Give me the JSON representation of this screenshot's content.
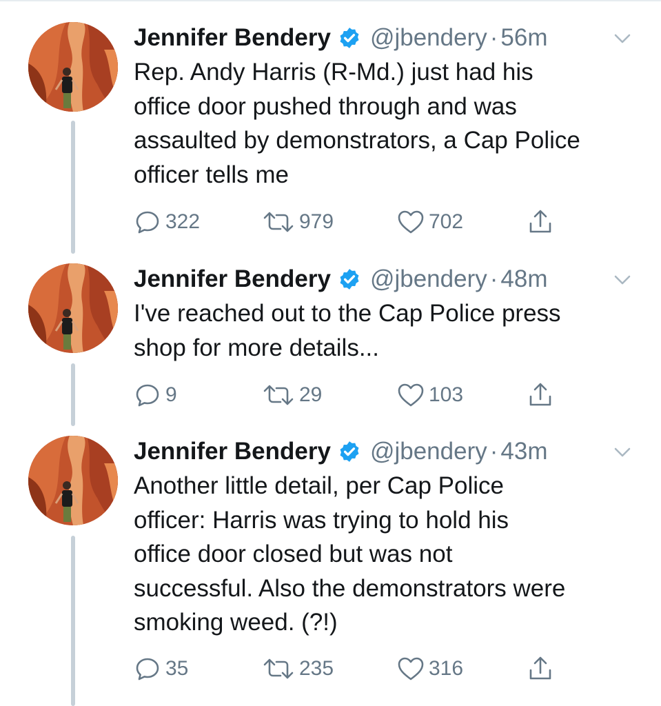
{
  "tweets": [
    {
      "name": "Jennifer Bendery",
      "handle": "@jbendery",
      "separator": "·",
      "time": "56m",
      "text": "Rep. Andy Harris (R-Md.) just had his\noffice door pushed through and was\nassaulted by demonstrators, a Cap Police\nofficer tells me",
      "replies": "322",
      "retweets": "979",
      "likes": "702"
    },
    {
      "name": "Jennifer Bendery",
      "handle": "@jbendery",
      "separator": "·",
      "time": "48m",
      "text": "I've reached out to the Cap Police press\nshop for more details...",
      "replies": "9",
      "retweets": "29",
      "likes": "103"
    },
    {
      "name": "Jennifer Bendery",
      "handle": "@jbendery",
      "separator": "·",
      "time": "43m",
      "text": "Another little detail, per Cap Police\nofficer: Harris was trying to hold his\noffice door closed but was not\nsuccessful. Also the demonstrators were\nsmoking weed. (?!)",
      "replies": "35",
      "retweets": "235",
      "likes": "316"
    }
  ],
  "icons": {
    "verified": "verified-badge-icon",
    "caret": "chevron-down-icon",
    "reply": "reply-icon",
    "retweet": "retweet-icon",
    "like": "heart-icon",
    "share": "share-icon"
  },
  "colors": {
    "verified_blue": "#1da1f2",
    "secondary_text": "#657786",
    "thread_line": "#c6d0d8"
  }
}
